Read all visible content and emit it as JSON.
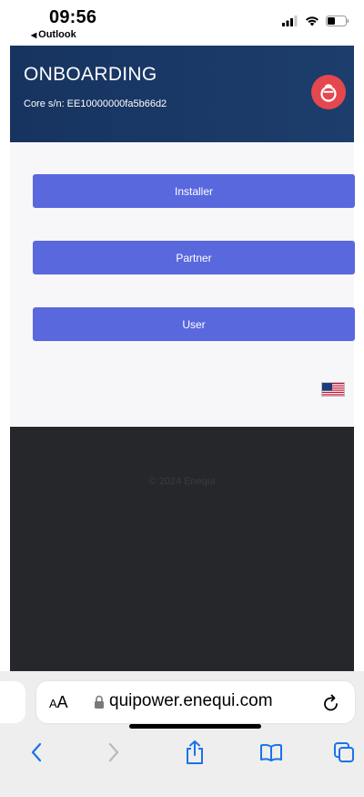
{
  "status_bar": {
    "time": "09:56",
    "back_app": "Outlook",
    "back_arrow": "◀"
  },
  "header": {
    "title": "ONBOARDING",
    "core_sn": "Core s/n: EE10000000fa5b66d2"
  },
  "roles": [
    {
      "label": "Installer"
    },
    {
      "label": "Partner"
    },
    {
      "label": "User"
    }
  ],
  "language": {
    "flag": "us-flag-icon"
  },
  "footer": {
    "copyright": "© 2024 Enequi"
  },
  "browser": {
    "aa_big": "A",
    "aa_small": "A",
    "url": "quipower.enequi.com"
  },
  "colors": {
    "header_bg": "#1b3866",
    "button": "#5a68de",
    "logo": "#e5474f",
    "footer_bg": "#26272b",
    "browser_accent": "#1a73e8"
  }
}
